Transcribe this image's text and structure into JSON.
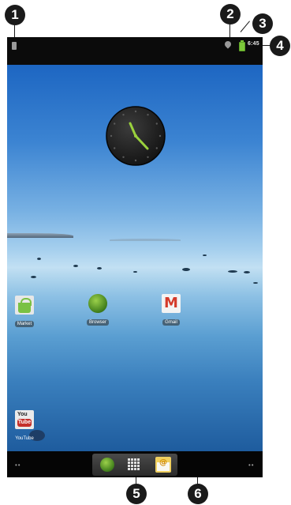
{
  "callouts": {
    "c1": "1",
    "c2": "2",
    "c3": "3",
    "c4": "4",
    "c5": "5",
    "c6": "6"
  },
  "status_bar": {
    "time": "6:45"
  },
  "home_screen": {
    "apps": [
      {
        "label": "Market",
        "icon": "market-icon"
      },
      {
        "label": "Browser",
        "icon": "browser-icon"
      },
      {
        "label": "Gmail",
        "icon": "gmail-icon"
      },
      {
        "label": "YouTube",
        "icon": "youtube-icon"
      }
    ]
  },
  "dock": {
    "left_dots": "••",
    "right_dots": "••",
    "gmail_icon_text": "M",
    "youtube_icon_text_top": "You",
    "youtube_icon_text_bottom": "Tube"
  },
  "colors": {
    "battery": "#7cc83a",
    "clock_hands": "#9ad13d"
  }
}
